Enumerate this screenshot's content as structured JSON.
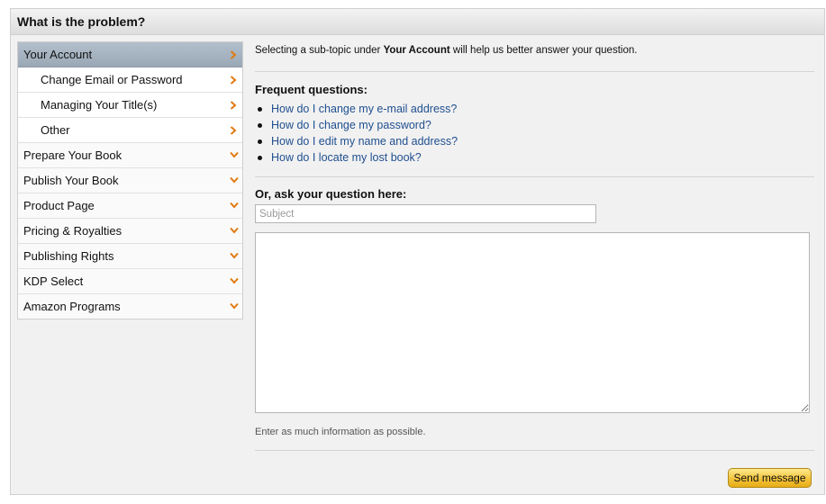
{
  "panel": {
    "title": "What is the problem?"
  },
  "sidebar": {
    "items": [
      {
        "label": "Your Account",
        "state": "active",
        "arrow": "chevron-right"
      },
      {
        "label": "Change Email or Password",
        "state": "sub",
        "arrow": "chevron-right"
      },
      {
        "label": "Managing Your Title(s)",
        "state": "sub",
        "arrow": "chevron-right"
      },
      {
        "label": "Other",
        "state": "sub",
        "arrow": "chevron-right"
      },
      {
        "label": "Prepare Your Book",
        "state": "collapsed",
        "arrow": "chevron-down"
      },
      {
        "label": "Publish Your Book",
        "state": "collapsed",
        "arrow": "chevron-down"
      },
      {
        "label": "Product Page",
        "state": "collapsed",
        "arrow": "chevron-down"
      },
      {
        "label": "Pricing & Royalties",
        "state": "collapsed",
        "arrow": "chevron-down"
      },
      {
        "label": "Publishing Rights",
        "state": "collapsed",
        "arrow": "chevron-down"
      },
      {
        "label": "KDP Select",
        "state": "collapsed",
        "arrow": "chevron-down"
      },
      {
        "label": "Amazon Programs",
        "state": "collapsed",
        "arrow": "chevron-down"
      }
    ]
  },
  "content": {
    "intro_prefix": "Selecting a sub-topic under ",
    "intro_topic": "Your Account",
    "intro_suffix": " will help us better answer your question.",
    "faq_title": "Frequent questions:",
    "faq": [
      "How do I change my e-mail address?",
      "How do I change my password?",
      "How do I edit my name and address?",
      "How do I locate my lost book?"
    ],
    "ask_title": "Or, ask your question here:",
    "subject_placeholder": "Subject",
    "subject_value": "",
    "message_value": "",
    "hint": "Enter as much information as possible.",
    "send_label": "Send message"
  },
  "colors": {
    "arrow": "#e07a10",
    "link": "#1f4f8f",
    "active_item": "#a6b3c0",
    "button": "#f3c33c"
  }
}
